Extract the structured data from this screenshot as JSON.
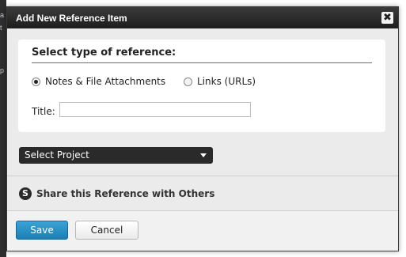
{
  "background": {
    "fragments": [
      "a",
      "t",
      "p"
    ]
  },
  "dialog": {
    "title": "Add New Reference Item",
    "close_glyph": "✖",
    "section_title": "Select type of reference:",
    "radio_options": [
      {
        "label": "Notes & File Attachments",
        "checked": true
      },
      {
        "label": "Links (URLs)",
        "checked": false
      }
    ],
    "title_field": {
      "label": "Title:",
      "value": "",
      "placeholder": ""
    },
    "project_select": {
      "selected": "Select Project"
    },
    "share": {
      "icon_glyph": "S",
      "label": "Share this Reference with Others"
    },
    "buttons": {
      "save": "Save",
      "cancel": "Cancel"
    }
  },
  "colors": {
    "titlebar": "#1d1d1d",
    "accent_save": "#1b7fb4",
    "dialog_bg": "#ebebeb"
  }
}
